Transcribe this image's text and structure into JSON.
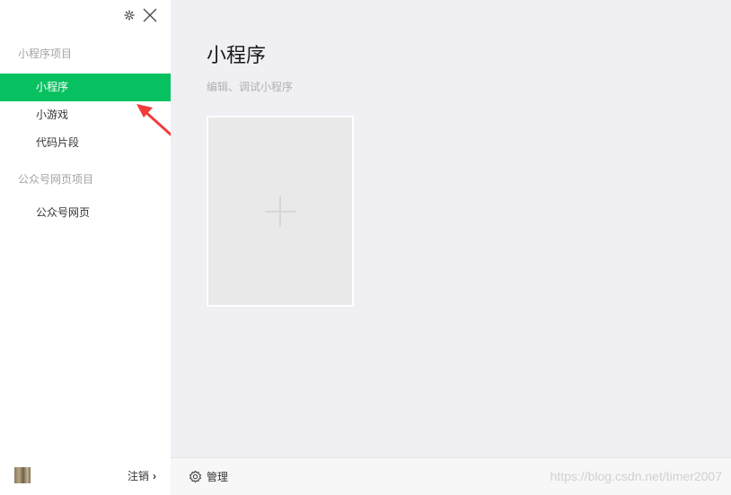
{
  "sidebar": {
    "sections": [
      {
        "title": "小程序项目",
        "items": [
          {
            "label": "小程序",
            "active": true
          },
          {
            "label": "小游戏",
            "active": false
          },
          {
            "label": "代码片段",
            "active": false
          }
        ]
      },
      {
        "title": "公众号网页项目",
        "items": [
          {
            "label": "公众号网页",
            "active": false
          }
        ]
      }
    ],
    "footer": {
      "logout_label": "注销",
      "chevron": "›"
    },
    "controls": {
      "settings_icon": "gear-icon",
      "close_icon": "close-icon"
    }
  },
  "main": {
    "title": "小程序",
    "subtitle": "编辑、调试小程序",
    "new_project_icon": "plus-icon"
  },
  "bottom_bar": {
    "manage_label": "管理",
    "watermark": "https://blog.csdn.net/timer2007"
  },
  "colors": {
    "accent": "#07c160",
    "sidebar_bg": "#ffffff",
    "main_bg": "#efeff4",
    "annotation": "#f23c3c"
  }
}
